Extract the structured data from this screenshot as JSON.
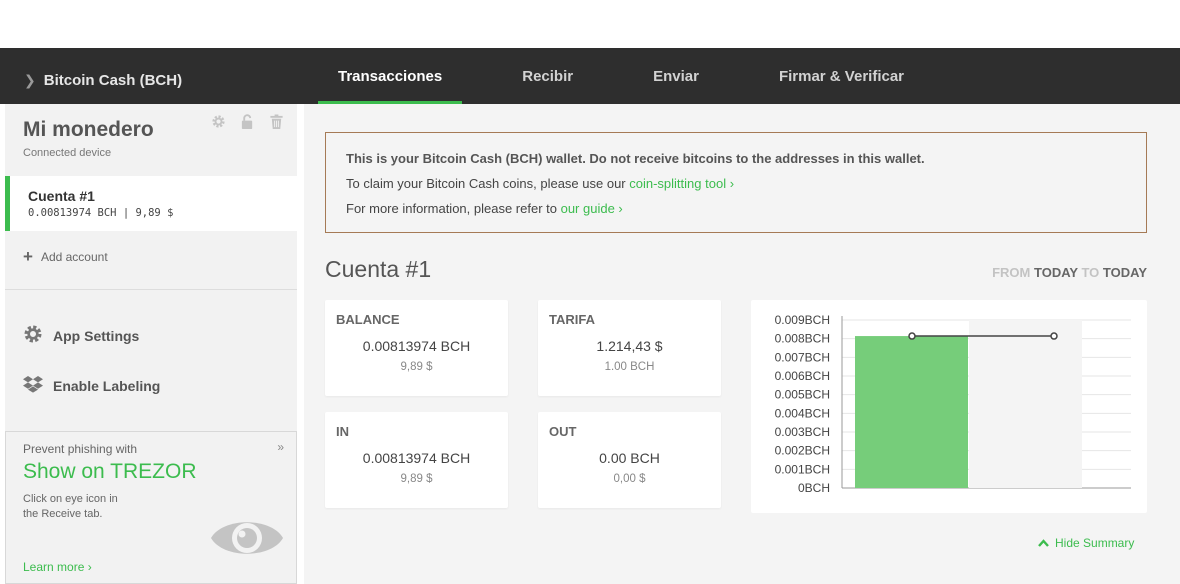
{
  "header": {
    "coin_title": "Bitcoin Cash (BCH)",
    "tabs": [
      {
        "label": "Transacciones",
        "active": true
      },
      {
        "label": "Recibir",
        "active": false
      },
      {
        "label": "Enviar",
        "active": false
      },
      {
        "label": "Firmar & Verificar",
        "active": false
      }
    ]
  },
  "sidebar": {
    "wallet_name": "Mi monedero",
    "wallet_status": "Connected device",
    "account": {
      "name": "Cuenta #1",
      "balance": "0.00813974 BCH | 9,89 $"
    },
    "add_account": "Add account",
    "menu": [
      {
        "label": "App Settings",
        "icon": "gear-icon"
      },
      {
        "label": "Enable Labeling",
        "icon": "dropbox-icon"
      }
    ],
    "promo": {
      "pre": "Prevent phishing with",
      "title": "Show on TREZOR",
      "desc": "Click on eye icon in the Receive tab.",
      "link": "Learn more ›",
      "close": "»"
    }
  },
  "notice": {
    "line1": "This is your Bitcoin Cash (BCH) wallet. Do not receive bitcoins to the addresses in this wallet.",
    "line2_text": "To claim your Bitcoin Cash coins, please use our ",
    "line2_link": "coin-splitting tool ›",
    "line3_text": "For more information, please refer to ",
    "line3_link": "our guide ›"
  },
  "summary": {
    "title": "Cuenta #1",
    "range": {
      "from": "FROM",
      "from_val": "TODAY",
      "to": "TO",
      "to_val": "TODAY"
    },
    "cards": [
      {
        "label": "BALANCE",
        "value": "0.00813974 BCH",
        "sub": "9,89 $"
      },
      {
        "label": "TARIFA",
        "value": "1.214,43 $",
        "sub": "1.00 BCH"
      },
      {
        "label": "IN",
        "value": "0.00813974 BCH",
        "sub": "9,89 $"
      },
      {
        "label": "OUT",
        "value": "0.00 BCH",
        "sub": "0,00 $"
      }
    ],
    "hide_summary": "Hide Summary"
  },
  "chart_data": {
    "type": "bar",
    "categories": [
      "",
      ""
    ],
    "values": [
      0.00813974,
      0
    ],
    "line_values": [
      0.00813974,
      0.00813974
    ],
    "ylim": [
      0,
      0.009
    ],
    "y_ticks": [
      "0BCH",
      "0.001BCH",
      "0.002BCH",
      "0.003BCH",
      "0.004BCH",
      "0.005BCH",
      "0.006BCH",
      "0.007BCH",
      "0.008BCH",
      "0.009BCH"
    ],
    "bar_color": "#76cd7a",
    "grid": true
  },
  "colors": {
    "accent": "#3cbc4e",
    "notice_border": "#a57a55",
    "topbar": "#2e2e2e"
  }
}
